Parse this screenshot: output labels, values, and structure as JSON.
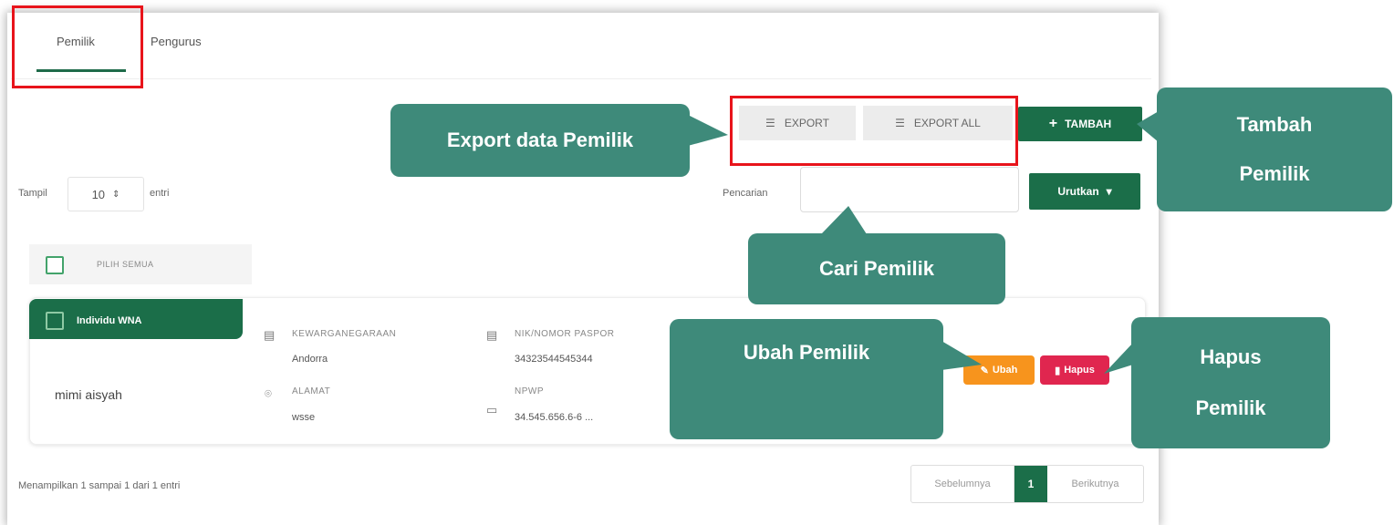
{
  "tabs": [
    {
      "label": "Pemilik"
    },
    {
      "label": "Pengurus"
    }
  ],
  "toolbar": {
    "export_label": "EXPORT",
    "export_all_label": "EXPORT ALL",
    "tambah_label": "TAMBAH"
  },
  "filters": {
    "show_label": "Tampil",
    "page_size": "10",
    "entries_label": "entri",
    "search_label": "Pencarian",
    "search_value": "",
    "sort_label": "Urutkan"
  },
  "select_all_label": "PILIH SEMUA",
  "record": {
    "type_badge": "Individu WNA",
    "name": "mimi aisyah",
    "fields": [
      {
        "label": "KEWARGANEGARAAN",
        "value": "Andorra",
        "icon": "id-card-icon"
      },
      {
        "label": "NIK/NOMOR PASPOR",
        "value": "34323544545344",
        "icon": "id-card-icon"
      },
      {
        "label": "ALAMAT",
        "value": "wsse",
        "icon": "map-pin-icon"
      },
      {
        "label": "NPWP",
        "value": "34.545.656.6-6 ...",
        "icon": "card-icon"
      }
    ],
    "edit_label": "Ubah",
    "delete_label": "Hapus"
  },
  "footer": {
    "info": "Menampilkan 1 sampai 1 dari 1 entri",
    "prev_label": "Sebelumnya",
    "page": "1",
    "next_label": "Berikutnya"
  },
  "callouts": {
    "export": "Export data Pemilik",
    "tambah_line1": "Tambah",
    "tambah_line2": "Pemilik",
    "cari": "Cari Pemilik",
    "ubah": "Ubah Pemilik",
    "hapus_line1": "Hapus",
    "hapus_line2": "Pemilik"
  },
  "colors": {
    "primary_green": "#1b6e49",
    "callout_teal": "#3e8a7a",
    "highlight_red": "#e8141b",
    "edit_orange": "#f7941d",
    "delete_red": "#e0264f"
  }
}
